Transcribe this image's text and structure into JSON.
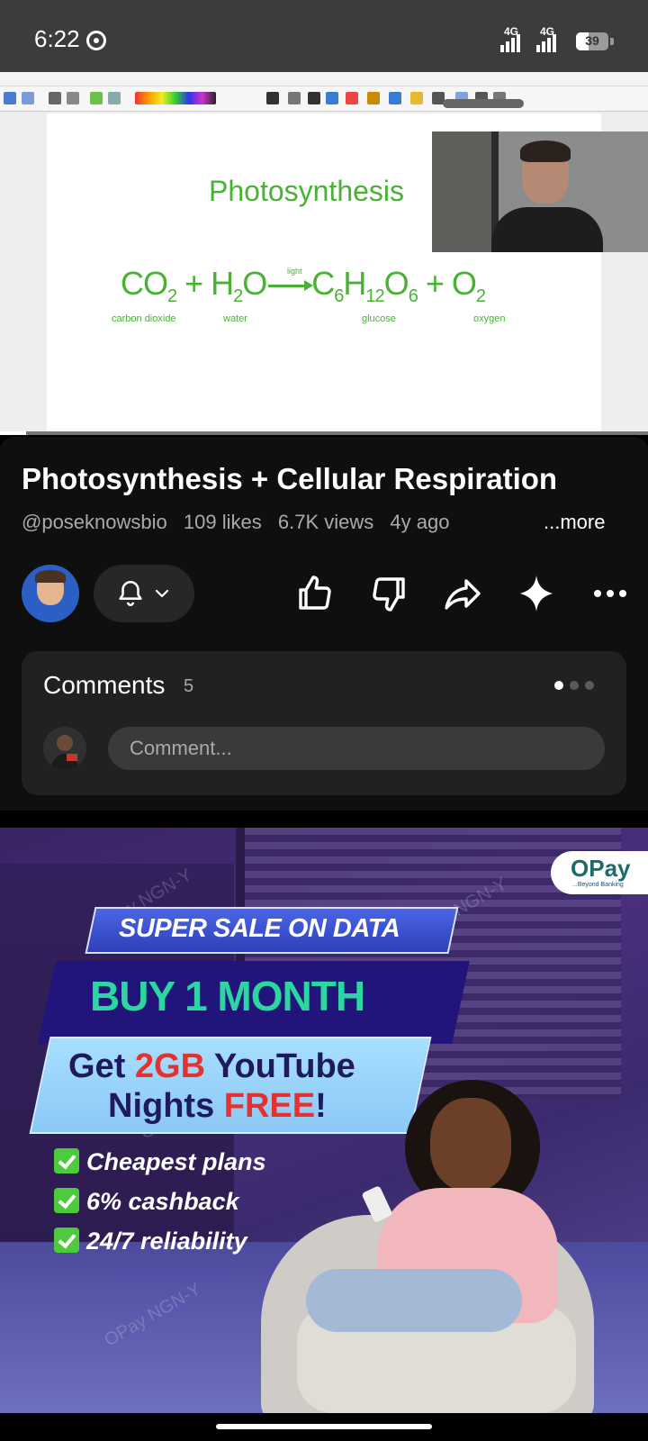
{
  "status_bar": {
    "time": "6:22",
    "network_1": "4G",
    "network_2": "4G",
    "battery": "39",
    "battery_level_percent": 39
  },
  "video": {
    "progress_fraction": 0.04,
    "slide": {
      "title": "Photosynthesis",
      "labels": {
        "light": "light",
        "carbon_dioxide": "carbon dioxide",
        "water": "water",
        "glucose": "glucose",
        "oxygen": "oxygen"
      }
    }
  },
  "video_info": {
    "title": "Photosynthesis + Cellular Respiration",
    "channel": "@poseknowsbio",
    "likes": "109 likes",
    "views": "6.7K views",
    "age": "4y ago",
    "more_label": "...more"
  },
  "comments": {
    "label": "Comments",
    "count": "5",
    "placeholder": "Comment..."
  },
  "ad": {
    "brand": "OPay",
    "brand_tagline": "...Beyond Banking",
    "banner": "SUPER SALE ON DATA",
    "headline": "BUY 1 MONTH",
    "offer_line1_a": "Get ",
    "offer_line1_b": "2GB",
    "offer_line1_c": " YouTube",
    "offer_line2_a": "Nights ",
    "offer_line2_b": "FREE",
    "offer_line2_c": "!",
    "bullets": [
      "Cheapest plans",
      "6% cashback",
      "24/7 reliability"
    ],
    "watermark": "OPay NGN-Y"
  },
  "colors": {
    "background": "#0f0f0f",
    "slide_green": "#49b235",
    "ad_teal": "#2bd6a0",
    "ad_red": "#e5322f"
  }
}
